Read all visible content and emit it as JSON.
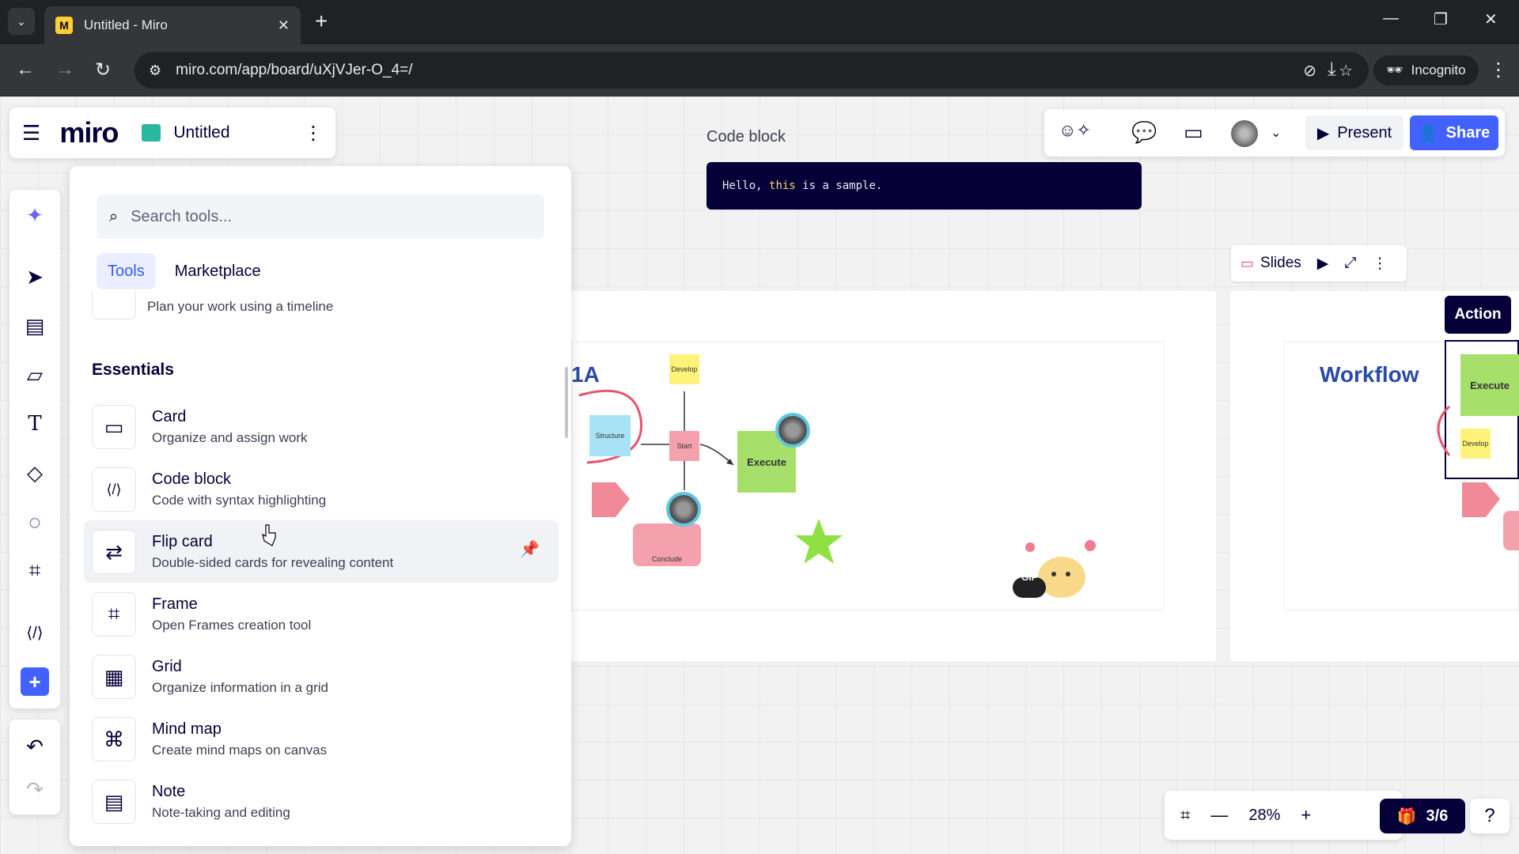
{
  "browser": {
    "tab_title": "Untitled - Miro",
    "url": "miro.com/app/board/uXjVJer-O_4=/",
    "incognito_label": "Incognito"
  },
  "board": {
    "logo": "miro",
    "title": "Untitled"
  },
  "panel": {
    "search_placeholder": "Search tools...",
    "tabs": [
      {
        "label": "Tools",
        "active": true
      },
      {
        "label": "Marketplace",
        "active": false
      }
    ],
    "cut_item_desc": "Plan your work using a timeline",
    "section_title": "Essentials",
    "items": [
      {
        "name": "Card",
        "desc": "Organize and assign work",
        "icon": "card-icon"
      },
      {
        "name": "Code block",
        "desc": "Code with syntax highlighting",
        "icon": "code-icon"
      },
      {
        "name": "Flip card",
        "desc": "Double-sided cards for revealing content",
        "icon": "flip-card-icon"
      },
      {
        "name": "Frame",
        "desc": "Open Frames creation tool",
        "icon": "frame-icon"
      },
      {
        "name": "Grid",
        "desc": "Organize information in a grid",
        "icon": "grid-icon"
      },
      {
        "name": "Mind map",
        "desc": "Create mind maps on canvas",
        "icon": "mind-map-icon"
      },
      {
        "name": "Note",
        "desc": "Note-taking and editing",
        "icon": "note-icon"
      }
    ]
  },
  "canvas": {
    "code_block_label": "Code block",
    "code_prefix": "Hello, ",
    "code_keyword": "this",
    "code_suffix": " is a sample.",
    "slides_label": "Slides",
    "action_label": "Action",
    "diagram1_title": "1A",
    "diagram2_title": "Workflow",
    "sticky_structure": "Structure",
    "sticky_start": "Start",
    "sticky_execute": "Execute",
    "sticky_develop": "Develop",
    "sticky_conclude": "Conclude",
    "gif_label": "GIF"
  },
  "topbar": {
    "present_label": "Present",
    "share_label": "Share"
  },
  "zoom": {
    "level": "28%",
    "pages": "3/6"
  },
  "colors": {
    "miro_navy": "#050038",
    "share_blue": "#4262ff",
    "sticky_yellow": "#fff27a",
    "sticky_green": "#a6e06b",
    "sticky_pink": "#f5a1ad",
    "sticky_blue": "#a7e3f5"
  }
}
